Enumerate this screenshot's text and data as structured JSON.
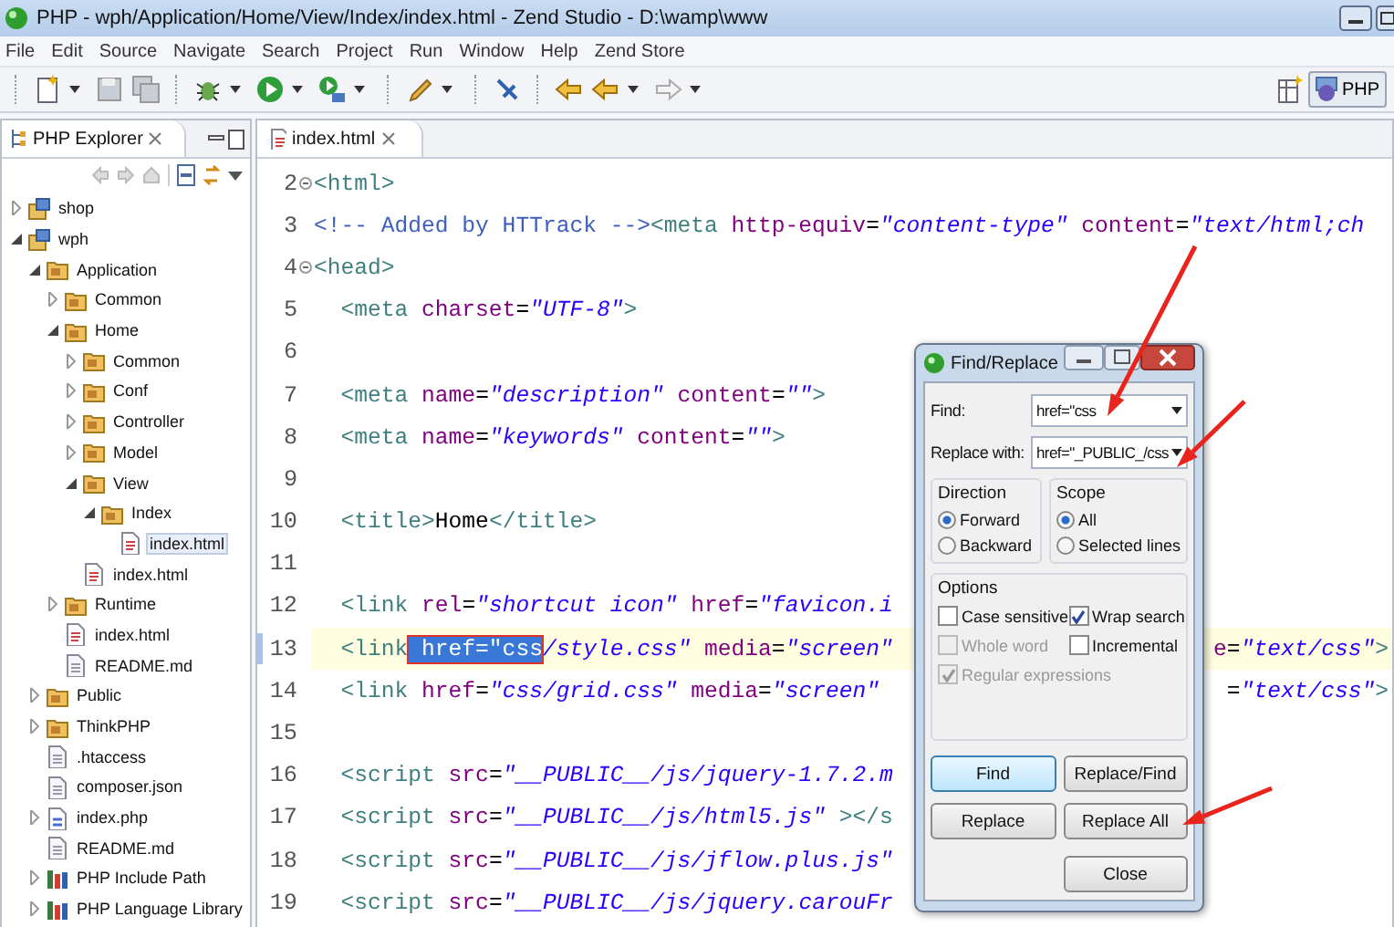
{
  "window": {
    "title": "PHP - wph/Application/Home/View/Index/index.html - Zend Studio - D:\\wamp\\www"
  },
  "menu": [
    "File",
    "Edit",
    "Source",
    "Navigate",
    "Search",
    "Project",
    "Run",
    "Window",
    "Help",
    "Zend Store"
  ],
  "perspective": {
    "label": "PHP",
    "selected": true
  },
  "explorer": {
    "tab": "PHP Explorer",
    "tree": [
      {
        "label": "shop",
        "kind": "project",
        "expanded": false,
        "selected": false
      },
      {
        "label": "wph",
        "kind": "project",
        "expanded": true,
        "selected": false,
        "children": [
          {
            "label": "Application",
            "kind": "folder",
            "expanded": true,
            "selected": false,
            "children": [
              {
                "label": "Common",
                "kind": "folder",
                "expanded": false,
                "selected": false
              },
              {
                "label": "Home",
                "kind": "folder",
                "expanded": true,
                "selected": false,
                "children": [
                  {
                    "label": "Common",
                    "kind": "folder",
                    "expanded": false,
                    "selected": false
                  },
                  {
                    "label": "Conf",
                    "kind": "folder",
                    "expanded": false,
                    "selected": false
                  },
                  {
                    "label": "Controller",
                    "kind": "folder",
                    "expanded": false,
                    "selected": false
                  },
                  {
                    "label": "Model",
                    "kind": "folder",
                    "expanded": false,
                    "selected": false
                  },
                  {
                    "label": "View",
                    "kind": "folder",
                    "expanded": true,
                    "selected": false,
                    "children": [
                      {
                        "label": "Index",
                        "kind": "folder",
                        "expanded": true,
                        "selected": false,
                        "children": [
                          {
                            "label": "index.html",
                            "kind": "html",
                            "selected": true
                          }
                        ]
                      }
                    ]
                  },
                  {
                    "label": "index.html",
                    "kind": "html",
                    "selected": false
                  }
                ]
              },
              {
                "label": "Runtime",
                "kind": "folder",
                "expanded": false,
                "selected": false
              },
              {
                "label": "index.html",
                "kind": "html",
                "selected": false
              },
              {
                "label": "README.md",
                "kind": "text",
                "selected": false
              }
            ]
          },
          {
            "label": "Public",
            "kind": "folder",
            "expanded": false,
            "selected": false
          },
          {
            "label": "ThinkPHP",
            "kind": "folder",
            "expanded": false,
            "selected": false
          },
          {
            "label": ".htaccess",
            "kind": "text",
            "selected": false
          },
          {
            "label": "composer.json",
            "kind": "text",
            "selected": false
          },
          {
            "label": "index.php",
            "kind": "php",
            "expanded": false,
            "selected": false
          },
          {
            "label": "README.md",
            "kind": "text",
            "selected": false
          },
          {
            "label": "PHP Include Path",
            "kind": "library",
            "expanded": false,
            "selected": false
          },
          {
            "label": "PHP Language Library",
            "kind": "library",
            "expanded": false,
            "selected": false
          }
        ]
      }
    ]
  },
  "editor": {
    "tab": "index.html",
    "lines": [
      {
        "number": "2",
        "fold": true,
        "current": false,
        "segments": [
          {
            "kind": "tag",
            "text": "<html>"
          }
        ]
      },
      {
        "number": "3",
        "fold": false,
        "current": false,
        "segments": [
          {
            "kind": "comment",
            "text": "<!-- Added by HTTrack -->"
          },
          {
            "kind": "tag",
            "text": "<meta"
          },
          {
            "kind": "attr",
            "text": " http-equiv"
          },
          {
            "kind": "plain",
            "text": "="
          },
          {
            "kind": "string",
            "text": "\"content-type\""
          },
          {
            "kind": "attr",
            "text": " content"
          },
          {
            "kind": "plain",
            "text": "="
          },
          {
            "kind": "string",
            "text": "\"text/html;ch"
          }
        ]
      },
      {
        "number": "4",
        "fold": true,
        "current": false,
        "segments": [
          {
            "kind": "tag",
            "text": "<head>"
          }
        ]
      },
      {
        "number": "5",
        "fold": false,
        "current": false,
        "segments": [
          {
            "kind": "tag",
            "text": "  <meta"
          },
          {
            "kind": "attr",
            "text": " charset"
          },
          {
            "kind": "plain",
            "text": "="
          },
          {
            "kind": "string",
            "text": "\"UTF-8\""
          },
          {
            "kind": "tag",
            "text": ">"
          }
        ]
      },
      {
        "number": "6",
        "fold": false,
        "current": false
      },
      {
        "number": "7",
        "fold": false,
        "current": false,
        "segments": [
          {
            "kind": "tag",
            "text": "  <meta"
          },
          {
            "kind": "attr",
            "text": " name"
          },
          {
            "kind": "plain",
            "text": "="
          },
          {
            "kind": "string",
            "text": "\"description\""
          },
          {
            "kind": "attr",
            "text": " content"
          },
          {
            "kind": "plain",
            "text": "="
          },
          {
            "kind": "string",
            "text": "\"\""
          },
          {
            "kind": "tag",
            "text": ">"
          }
        ]
      },
      {
        "number": "8",
        "fold": false,
        "current": false,
        "segments": [
          {
            "kind": "tag",
            "text": "  <meta"
          },
          {
            "kind": "attr",
            "text": " name"
          },
          {
            "kind": "plain",
            "text": "="
          },
          {
            "kind": "string",
            "text": "\"keywords\""
          },
          {
            "kind": "attr",
            "text": " content"
          },
          {
            "kind": "plain",
            "text": "="
          },
          {
            "kind": "string",
            "text": "\"\""
          },
          {
            "kind": "tag",
            "text": ">"
          }
        ]
      },
      {
        "number": "9",
        "fold": false,
        "current": false
      },
      {
        "number": "10",
        "fold": false,
        "current": false,
        "segments": [
          {
            "kind": "tag",
            "text": "  <title>"
          },
          {
            "kind": "plain",
            "text": "Home"
          },
          {
            "kind": "tag",
            "text": "</title>"
          }
        ]
      },
      {
        "number": "11",
        "fold": false,
        "current": false
      },
      {
        "number": "12",
        "fold": false,
        "current": false,
        "segments": [
          {
            "kind": "tag",
            "text": "  <link"
          },
          {
            "kind": "attr",
            "text": " rel"
          },
          {
            "kind": "plain",
            "text": "="
          },
          {
            "kind": "string",
            "text": "\"shortcut icon\""
          },
          {
            "kind": "attr",
            "text": " href"
          },
          {
            "kind": "plain",
            "text": "="
          },
          {
            "kind": "string",
            "text": "\"favicon.i"
          }
        ]
      },
      {
        "number": "13",
        "fold": false,
        "current": true,
        "segments": [
          {
            "kind": "tag",
            "text": "  <link"
          },
          {
            "kind": "selected",
            "text": " href=\"css"
          },
          {
            "kind": "string",
            "text": "/style.css\""
          },
          {
            "kind": "attr",
            "text": " media"
          },
          {
            "kind": "plain",
            "text": "="
          },
          {
            "kind": "string",
            "text": "\"screen\""
          }
        ],
        "right_segments": [
          {
            "kind": "attr",
            "text": "e"
          },
          {
            "kind": "plain",
            "text": "="
          },
          {
            "kind": "string",
            "text": "\"text/css\""
          },
          {
            "kind": "tag",
            "text": ">"
          }
        ]
      },
      {
        "number": "14",
        "fold": false,
        "current": false,
        "segments": [
          {
            "kind": "tag",
            "text": "  <link"
          },
          {
            "kind": "attr",
            "text": " href"
          },
          {
            "kind": "plain",
            "text": "="
          },
          {
            "kind": "string",
            "text": "\"css/grid.css\""
          },
          {
            "kind": "attr",
            "text": " media"
          },
          {
            "kind": "plain",
            "text": "="
          },
          {
            "kind": "string",
            "text": "\"screen\""
          }
        ],
        "right_segments": [
          {
            "kind": "plain",
            "text": "="
          },
          {
            "kind": "string",
            "text": "\"text/css\""
          },
          {
            "kind": "tag",
            "text": ">"
          }
        ]
      },
      {
        "number": "15",
        "fold": false,
        "current": false
      },
      {
        "number": "16",
        "fold": false,
        "current": false,
        "segments": [
          {
            "kind": "tag",
            "text": "  <script"
          },
          {
            "kind": "attr",
            "text": " src"
          },
          {
            "kind": "plain",
            "text": "="
          },
          {
            "kind": "string",
            "text": "\"__PUBLIC__/js/jquery-1.7.2.m"
          }
        ]
      },
      {
        "number": "17",
        "fold": false,
        "current": false,
        "segments": [
          {
            "kind": "tag",
            "text": "  <script"
          },
          {
            "kind": "attr",
            "text": " src"
          },
          {
            "kind": "plain",
            "text": "="
          },
          {
            "kind": "string",
            "text": "\"__PUBLIC__/js/html5.js\""
          },
          {
            "kind": "tag",
            "text": " ></s"
          }
        ]
      },
      {
        "number": "18",
        "fold": false,
        "current": false,
        "segments": [
          {
            "kind": "tag",
            "text": "  <script"
          },
          {
            "kind": "attr",
            "text": " src"
          },
          {
            "kind": "plain",
            "text": "="
          },
          {
            "kind": "string",
            "text": "\"__PUBLIC__/js/jflow.plus.js\""
          }
        ]
      },
      {
        "number": "19",
        "fold": false,
        "current": false,
        "segments": [
          {
            "kind": "tag",
            "text": "  <script"
          },
          {
            "kind": "attr",
            "text": " src"
          },
          {
            "kind": "plain",
            "text": "="
          },
          {
            "kind": "string",
            "text": "\"__PUBLIC__/js/jquery.carouFr"
          }
        ]
      }
    ]
  },
  "find_replace": {
    "title": "Find/Replace",
    "find": {
      "label": "Find:",
      "value": "href=\"css"
    },
    "replace": {
      "label": "Replace with:",
      "value": "href=\"_PUBLIC_/css"
    },
    "direction": {
      "label": "Direction",
      "options": [
        {
          "label": "Forward",
          "selected": true
        },
        {
          "label": "Backward",
          "selected": false
        }
      ]
    },
    "scope": {
      "label": "Scope",
      "options": [
        {
          "label": "All",
          "selected": true
        },
        {
          "label": "Selected lines",
          "selected": false
        }
      ]
    },
    "options": {
      "label": "Options",
      "items": [
        {
          "label": "Case sensitive",
          "checked": false,
          "disabled": false
        },
        {
          "label": "Wrap search",
          "checked": true,
          "disabled": false
        },
        {
          "label": "Whole word",
          "checked": false,
          "disabled": true
        },
        {
          "label": "Incremental",
          "checked": false,
          "disabled": false
        },
        {
          "label": "Regular expressions",
          "checked": true,
          "disabled": true
        }
      ]
    },
    "buttons": [
      {
        "label": "Find",
        "default": true
      },
      {
        "label": "Replace/Find",
        "default": false
      },
      {
        "label": "Replace",
        "default": false
      },
      {
        "label": "Replace All",
        "default": false
      },
      {
        "label": "Close",
        "default": false
      }
    ]
  }
}
